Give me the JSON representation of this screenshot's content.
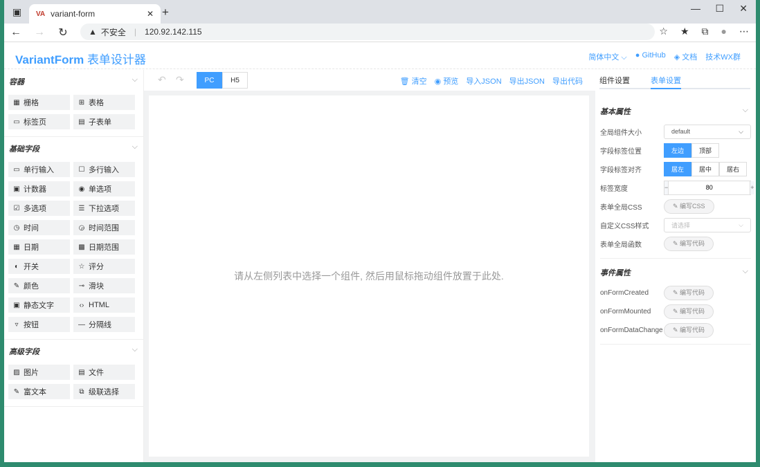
{
  "browser": {
    "tab_icon": "VA",
    "tab_title": "variant-form",
    "security": "不安全",
    "url": "120.92.142.115"
  },
  "header": {
    "brand": "VariantForm",
    "brand_suffix": "表单设计器",
    "lang": "简体中文",
    "github": "GitHub",
    "docs": "文档",
    "group": "技术WX群"
  },
  "left": {
    "sections": [
      {
        "title": "容器",
        "items": [
          {
            "icon": "▦",
            "label": "栅格"
          },
          {
            "icon": "⊞",
            "label": "表格"
          },
          {
            "icon": "▭",
            "label": "标签页"
          },
          {
            "icon": "▤",
            "label": "子表单"
          }
        ]
      },
      {
        "title": "基础字段",
        "items": [
          {
            "icon": "▭",
            "label": "单行输入"
          },
          {
            "icon": "☐",
            "label": "多行输入"
          },
          {
            "icon": "▣",
            "label": "计数器"
          },
          {
            "icon": "◉",
            "label": "单选项"
          },
          {
            "icon": "☑",
            "label": "多选项"
          },
          {
            "icon": "☰",
            "label": "下拉选项"
          },
          {
            "icon": "◷",
            "label": "时间"
          },
          {
            "icon": "◶",
            "label": "时间范围"
          },
          {
            "icon": "▦",
            "label": "日期"
          },
          {
            "icon": "▩",
            "label": "日期范围"
          },
          {
            "icon": "◐",
            "label": "开关"
          },
          {
            "icon": "☆",
            "label": "评分"
          },
          {
            "icon": "✎",
            "label": "颜色"
          },
          {
            "icon": "⊸",
            "label": "滑块"
          },
          {
            "icon": "▣",
            "label": "静态文字"
          },
          {
            "icon": "‹›",
            "label": "HTML"
          },
          {
            "icon": "▿",
            "label": "按钮"
          },
          {
            "icon": "—",
            "label": "分隔线"
          }
        ]
      },
      {
        "title": "高级字段",
        "items": [
          {
            "icon": "▨",
            "label": "图片"
          },
          {
            "icon": "▤",
            "label": "文件"
          },
          {
            "icon": "✎",
            "label": "富文本"
          },
          {
            "icon": "⧉",
            "label": "级联选择"
          }
        ]
      }
    ]
  },
  "toolbar": {
    "pc": "PC",
    "h5": "H5",
    "clear": "清空",
    "preview": "预览",
    "import_json": "导入JSON",
    "export_json": "导出JSON",
    "export_code": "导出代码"
  },
  "canvas": {
    "hint": "请从左侧列表中选择一个组件, 然后用鼠标拖动组件放置于此处."
  },
  "right": {
    "tab_widget": "组件设置",
    "tab_form": "表单设置",
    "basic": "基本属性",
    "size_label": "全局组件大小",
    "size_value": "default",
    "pos_label": "字段标签位置",
    "pos_left": "左边",
    "pos_top": "顶部",
    "align_label": "字段标签对齐",
    "align_left": "居左",
    "align_center": "居中",
    "align_right": "居右",
    "width_label": "标签宽度",
    "width_value": "80",
    "css_label": "表单全局CSS",
    "css_btn": "编写CSS",
    "custom_css_label": "自定义CSS样式",
    "custom_css_placeholder": "请选择",
    "func_label": "表单全局函数",
    "code_btn": "编写代码",
    "events": "事件属性",
    "ev1": "onFormCreated",
    "ev2": "onFormMounted",
    "ev3": "onFormDataChange"
  }
}
